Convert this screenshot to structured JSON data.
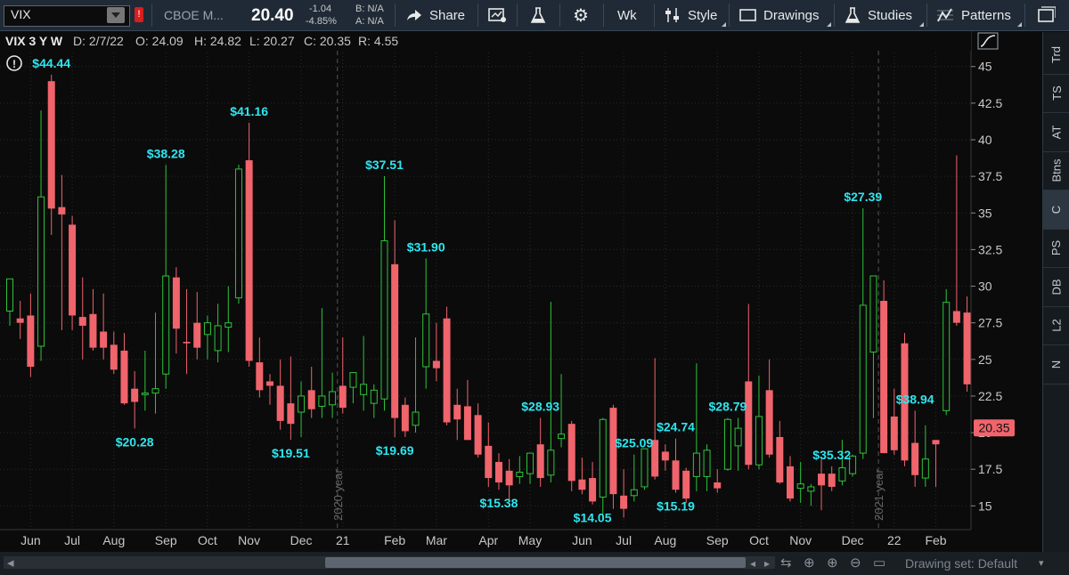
{
  "toolbar": {
    "symbol": "VIX",
    "alert_badge": "!",
    "company": "CBOE M...",
    "last": "20.40",
    "net_change": "-1.04",
    "pct_change": "-4.85%",
    "bid": "B: N/A",
    "ask": "A: N/A",
    "share_label": "Share",
    "aggregation_label": "Wk",
    "style_label": "Style",
    "drawings_label": "Drawings",
    "studies_label": "Studies",
    "patterns_label": "Patterns"
  },
  "chart_header": {
    "description": "VIX 3 Y W",
    "date": "D: 2/7/22",
    "open": "O: 24.09",
    "high": "H: 24.82",
    "low": "L: 20.27",
    "close": "C: 20.35",
    "range": "R: 4.55"
  },
  "right_tabs": [
    "Trd",
    "TS",
    "AT",
    "Btns",
    "C",
    "PS",
    "DB",
    "L2",
    "N"
  ],
  "status_bar": {
    "drawing_set": "Drawing set: Default"
  },
  "colors": {
    "up": "#2ec43a",
    "down": "#f0646c",
    "label": "#2ee6f0",
    "grid": "#2b2b2b",
    "price_tag": "#f0646c"
  },
  "chart_data": {
    "type": "candlestick",
    "y_ticks": [
      "15",
      "17.5",
      "20",
      "22.5",
      "25",
      "27.5",
      "30",
      "32.5",
      "35",
      "37.5",
      "40",
      "42.5",
      "45"
    ],
    "ylim": [
      13.5,
      46.2
    ],
    "x_labels": [
      {
        "label": "Jun",
        "i": 2
      },
      {
        "label": "Jul",
        "i": 6
      },
      {
        "label": "Aug",
        "i": 10
      },
      {
        "label": "Sep",
        "i": 15
      },
      {
        "label": "Oct",
        "i": 19
      },
      {
        "label": "Nov",
        "i": 23
      },
      {
        "label": "Dec",
        "i": 28
      },
      {
        "label": "21",
        "i": 32
      },
      {
        "label": "Feb",
        "i": 37
      },
      {
        "label": "Mar",
        "i": 41
      },
      {
        "label": "Apr",
        "i": 46
      },
      {
        "label": "May",
        "i": 50
      },
      {
        "label": "Jun",
        "i": 55
      },
      {
        "label": "Jul",
        "i": 59
      },
      {
        "label": "Aug",
        "i": 63
      },
      {
        "label": "Sep",
        "i": 68
      },
      {
        "label": "Oct",
        "i": 72
      },
      {
        "label": "Nov",
        "i": 76
      },
      {
        "label": "Dec",
        "i": 81
      },
      {
        "label": "22",
        "i": 85
      },
      {
        "label": "Feb",
        "i": 89
      }
    ],
    "year_markers": [
      {
        "label": "2020 year",
        "i": 32
      },
      {
        "label": "2021 year",
        "i": 84
      }
    ],
    "annotations": [
      {
        "text": "$44.44",
        "i": 4,
        "pos": "above"
      },
      {
        "text": "$38.28",
        "i": 15,
        "pos": "above"
      },
      {
        "text": "$20.28",
        "i": 12,
        "pos": "below"
      },
      {
        "text": "$41.16",
        "i": 23,
        "pos": "above"
      },
      {
        "text": "$19.51",
        "i": 27,
        "pos": "below"
      },
      {
        "text": "$37.51",
        "i": 36,
        "pos": "above"
      },
      {
        "text": "$19.69",
        "i": 37,
        "pos": "below"
      },
      {
        "text": "$31.90",
        "i": 40,
        "pos": "above"
      },
      {
        "text": "$15.38",
        "i": 47,
        "pos": "below"
      },
      {
        "text": "$28.93",
        "i": 51,
        "pos": "above"
      },
      {
        "text": "$14.05",
        "i": 56,
        "pos": "below"
      },
      {
        "text": "$25.09",
        "i": 60,
        "pos": "above"
      },
      {
        "text": "$24.74",
        "i": 64,
        "pos": "above"
      },
      {
        "text": "$15.19",
        "i": 64,
        "pos": "below"
      },
      {
        "text": "$28.79",
        "i": 69,
        "pos": "above"
      },
      {
        "text": "$35.32",
        "i": 79,
        "pos": "above"
      },
      {
        "text": "$27.39",
        "i": 82,
        "pos": "above"
      },
      {
        "text": "$38.94",
        "i": 87,
        "pos": "above"
      }
    ],
    "last_price_tag": "20.35",
    "candles": [
      {
        "o": 28.3,
        "h": 29.6,
        "l": 27.3,
        "c": 30.5
      },
      {
        "o": 27.8,
        "h": 29.0,
        "l": 26.4,
        "c": 27.5
      },
      {
        "o": 28.0,
        "h": 29.5,
        "l": 23.8,
        "c": 24.5
      },
      {
        "o": 25.9,
        "h": 42.0,
        "l": 24.9,
        "c": 36.1
      },
      {
        "o": 44.0,
        "h": 44.44,
        "l": 33.5,
        "c": 35.3
      },
      {
        "o": 35.4,
        "h": 37.6,
        "l": 27.0,
        "c": 34.9
      },
      {
        "o": 34.2,
        "h": 34.8,
        "l": 27.0,
        "c": 28.0
      },
      {
        "o": 27.9,
        "h": 30.6,
        "l": 25.0,
        "c": 27.3
      },
      {
        "o": 28.1,
        "h": 29.8,
        "l": 25.6,
        "c": 25.8
      },
      {
        "o": 26.9,
        "h": 29.5,
        "l": 25.0,
        "c": 25.8
      },
      {
        "o": 26.0,
        "h": 26.9,
        "l": 24.0,
        "c": 24.3
      },
      {
        "o": 25.6,
        "h": 26.8,
        "l": 21.9,
        "c": 22.0
      },
      {
        "o": 23.0,
        "h": 24.2,
        "l": 20.28,
        "c": 22.1
      },
      {
        "o": 22.6,
        "h": 25.6,
        "l": 21.5,
        "c": 22.7
      },
      {
        "o": 22.7,
        "h": 28.2,
        "l": 21.3,
        "c": 23.0
      },
      {
        "o": 24.0,
        "h": 38.28,
        "l": 23.0,
        "c": 30.7
      },
      {
        "o": 30.6,
        "h": 31.3,
        "l": 25.4,
        "c": 27.1
      },
      {
        "o": 26.2,
        "h": 29.8,
        "l": 24.0,
        "c": 26.1
      },
      {
        "o": 27.5,
        "h": 29.6,
        "l": 25.0,
        "c": 25.8
      },
      {
        "o": 26.7,
        "h": 28.0,
        "l": 25.0,
        "c": 27.5
      },
      {
        "o": 25.6,
        "h": 28.8,
        "l": 24.8,
        "c": 27.3
      },
      {
        "o": 27.2,
        "h": 30.0,
        "l": 25.5,
        "c": 27.5
      },
      {
        "o": 29.2,
        "h": 38.3,
        "l": 28.8,
        "c": 38.0
      },
      {
        "o": 38.6,
        "h": 41.16,
        "l": 24.5,
        "c": 24.9
      },
      {
        "o": 24.8,
        "h": 26.5,
        "l": 22.4,
        "c": 22.9
      },
      {
        "o": 23.5,
        "h": 24.0,
        "l": 21.9,
        "c": 23.2
      },
      {
        "o": 23.2,
        "h": 25.0,
        "l": 20.2,
        "c": 20.8
      },
      {
        "o": 22.0,
        "h": 25.2,
        "l": 19.51,
        "c": 20.6
      },
      {
        "o": 21.4,
        "h": 23.5,
        "l": 19.7,
        "c": 22.5
      },
      {
        "o": 22.9,
        "h": 24.5,
        "l": 21.0,
        "c": 21.6
      },
      {
        "o": 21.8,
        "h": 28.5,
        "l": 21.0,
        "c": 22.5
      },
      {
        "o": 21.9,
        "h": 24.1,
        "l": 21.0,
        "c": 22.8
      },
      {
        "o": 23.2,
        "h": 26.5,
        "l": 21.3,
        "c": 21.7
      },
      {
        "o": 23.1,
        "h": 23.9,
        "l": 22.0,
        "c": 24.1
      },
      {
        "o": 22.6,
        "h": 26.6,
        "l": 21.5,
        "c": 23.3
      },
      {
        "o": 22.0,
        "h": 23.3,
        "l": 21.0,
        "c": 22.9
      },
      {
        "o": 22.3,
        "h": 37.51,
        "l": 21.5,
        "c": 33.1
      },
      {
        "o": 31.5,
        "h": 34.5,
        "l": 19.69,
        "c": 21.0
      },
      {
        "o": 21.9,
        "h": 22.4,
        "l": 19.7,
        "c": 20.1
      },
      {
        "o": 20.5,
        "h": 26.5,
        "l": 20.0,
        "c": 21.4
      },
      {
        "o": 24.5,
        "h": 31.9,
        "l": 23.0,
        "c": 28.1
      },
      {
        "o": 24.9,
        "h": 27.5,
        "l": 23.5,
        "c": 24.4
      },
      {
        "o": 27.8,
        "h": 28.6,
        "l": 20.5,
        "c": 20.7
      },
      {
        "o": 21.9,
        "h": 23.0,
        "l": 19.5,
        "c": 20.9
      },
      {
        "o": 21.8,
        "h": 23.6,
        "l": 19.8,
        "c": 19.5
      },
      {
        "o": 21.2,
        "h": 22.0,
        "l": 18.3,
        "c": 18.5
      },
      {
        "o": 19.1,
        "h": 20.7,
        "l": 16.3,
        "c": 16.9
      },
      {
        "o": 18.0,
        "h": 18.6,
        "l": 16.1,
        "c": 16.6
      },
      {
        "o": 17.4,
        "h": 18.2,
        "l": 15.38,
        "c": 16.4
      },
      {
        "o": 17.0,
        "h": 18.4,
        "l": 16.5,
        "c": 17.3
      },
      {
        "o": 17.2,
        "h": 18.3,
        "l": 16.5,
        "c": 18.6
      },
      {
        "o": 19.2,
        "h": 21.0,
        "l": 16.3,
        "c": 16.9
      },
      {
        "o": 17.1,
        "h": 28.93,
        "l": 16.6,
        "c": 18.8
      },
      {
        "o": 19.6,
        "h": 24.0,
        "l": 19.0,
        "c": 19.9
      },
      {
        "o": 20.6,
        "h": 20.8,
        "l": 16.0,
        "c": 16.7
      },
      {
        "o": 16.8,
        "h": 18.3,
        "l": 15.8,
        "c": 16.1
      },
      {
        "o": 16.9,
        "h": 18.0,
        "l": 15.1,
        "c": 15.3
      },
      {
        "o": 15.6,
        "h": 21.0,
        "l": 14.05,
        "c": 20.9
      },
      {
        "o": 21.7,
        "h": 21.9,
        "l": 14.8,
        "c": 15.8
      },
      {
        "o": 15.7,
        "h": 17.5,
        "l": 14.2,
        "c": 14.8
      },
      {
        "o": 15.7,
        "h": 18.5,
        "l": 15.3,
        "c": 16.1
      },
      {
        "o": 16.3,
        "h": 18.8,
        "l": 16.1,
        "c": 18.9
      },
      {
        "o": 19.5,
        "h": 25.09,
        "l": 16.8,
        "c": 17.0
      },
      {
        "o": 18.7,
        "h": 19.2,
        "l": 17.4,
        "c": 18.1
      },
      {
        "o": 18.1,
        "h": 19.6,
        "l": 15.9,
        "c": 16.1
      },
      {
        "o": 17.4,
        "h": 17.6,
        "l": 15.19,
        "c": 15.5
      },
      {
        "o": 17.0,
        "h": 24.74,
        "l": 16.0,
        "c": 18.6
      },
      {
        "o": 17.0,
        "h": 19.2,
        "l": 16.0,
        "c": 18.8
      },
      {
        "o": 16.6,
        "h": 17.5,
        "l": 15.9,
        "c": 16.2
      },
      {
        "o": 17.5,
        "h": 21.0,
        "l": 17.4,
        "c": 20.9
      },
      {
        "o": 19.1,
        "h": 21.0,
        "l": 17.4,
        "c": 20.3
      },
      {
        "o": 23.5,
        "h": 28.79,
        "l": 17.5,
        "c": 17.8
      },
      {
        "o": 17.8,
        "h": 23.9,
        "l": 17.5,
        "c": 21.1
      },
      {
        "o": 22.9,
        "h": 25.0,
        "l": 18.3,
        "c": 18.5
      },
      {
        "o": 19.7,
        "h": 20.8,
        "l": 16.5,
        "c": 16.6
      },
      {
        "o": 17.7,
        "h": 18.4,
        "l": 15.3,
        "c": 15.5
      },
      {
        "o": 16.2,
        "h": 18.0,
        "l": 15.2,
        "c": 16.5
      },
      {
        "o": 16.0,
        "h": 16.5,
        "l": 15.0,
        "c": 16.3
      },
      {
        "o": 17.2,
        "h": 18.2,
        "l": 14.7,
        "c": 16.4
      },
      {
        "o": 17.2,
        "h": 17.7,
        "l": 16.0,
        "c": 16.3
      },
      {
        "o": 16.7,
        "h": 19.5,
        "l": 16.4,
        "c": 17.6
      },
      {
        "o": 17.2,
        "h": 18.5,
        "l": 17.0,
        "c": 18.4
      },
      {
        "o": 18.6,
        "h": 35.32,
        "l": 18.2,
        "c": 28.7
      },
      {
        "o": 25.5,
        "h": 30.7,
        "l": 21.0,
        "c": 30.7
      },
      {
        "o": 29.0,
        "h": 30.4,
        "l": 18.6,
        "c": 18.6
      },
      {
        "o": 21.1,
        "h": 23.0,
        "l": 18.5,
        "c": 18.8
      },
      {
        "o": 26.1,
        "h": 26.8,
        "l": 17.7,
        "c": 18.1
      },
      {
        "o": 19.3,
        "h": 21.5,
        "l": 16.3,
        "c": 17.1
      },
      {
        "o": 16.9,
        "h": 20.5,
        "l": 16.3,
        "c": 18.2
      },
      {
        "o": 19.5,
        "h": 19.5,
        "l": 16.3,
        "c": 19.2
      },
      {
        "o": 21.5,
        "h": 29.8,
        "l": 21.2,
        "c": 28.9
      },
      {
        "o": 28.3,
        "h": 38.94,
        "l": 27.3,
        "c": 27.5
      },
      {
        "o": 28.2,
        "h": 29.3,
        "l": 22.8,
        "c": 23.3
      },
      {
        "o": 24.09,
        "h": 24.82,
        "l": 20.27,
        "c": 20.35
      }
    ]
  }
}
